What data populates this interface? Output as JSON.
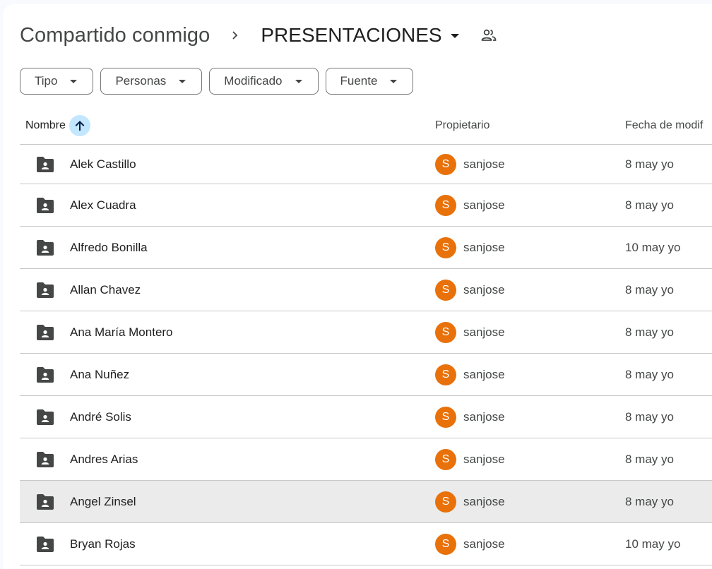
{
  "breadcrumb": {
    "root": "Compartido conmigo",
    "current": "PRESENTACIONES"
  },
  "filters": [
    {
      "label": "Tipo"
    },
    {
      "label": "Personas"
    },
    {
      "label": "Modificado"
    },
    {
      "label": "Fuente"
    }
  ],
  "table": {
    "columns": {
      "name": "Nombre",
      "owner": "Propietario",
      "date": "Fecha de modif"
    },
    "sort": "ascending",
    "rows": [
      {
        "name": "Alek Castillo",
        "owner": "sanjose",
        "owner_initial": "S",
        "date": "8 may yo",
        "selected": false
      },
      {
        "name": "Alex Cuadra",
        "owner": "sanjose",
        "owner_initial": "S",
        "date": "8 may yo",
        "selected": false
      },
      {
        "name": "Alfredo Bonilla",
        "owner": "sanjose",
        "owner_initial": "S",
        "date": "10 may yo",
        "selected": false
      },
      {
        "name": "Allan Chavez",
        "owner": "sanjose",
        "owner_initial": "S",
        "date": "8 may yo",
        "selected": false
      },
      {
        "name": "Ana María Montero",
        "owner": "sanjose",
        "owner_initial": "S",
        "date": "8 may yo",
        "selected": false
      },
      {
        "name": "Ana Nuñez",
        "owner": "sanjose",
        "owner_initial": "S",
        "date": "8 may yo",
        "selected": false
      },
      {
        "name": "André Solis",
        "owner": "sanjose",
        "owner_initial": "S",
        "date": "8 may yo",
        "selected": false
      },
      {
        "name": "Andres Arias",
        "owner": "sanjose",
        "owner_initial": "S",
        "date": "8 may yo",
        "selected": false
      },
      {
        "name": "Angel Zinsel",
        "owner": "sanjose",
        "owner_initial": "S",
        "date": "8 may yo",
        "selected": true
      },
      {
        "name": "Bryan Rojas",
        "owner": "sanjose",
        "owner_initial": "S",
        "date": "10 may yo",
        "selected": false
      }
    ]
  },
  "colors": {
    "avatar": "#e8710a",
    "sort_button": "#c2e7ff",
    "selected_row": "#ebebeb"
  },
  "icons": {
    "folder": "shared-folder-icon",
    "shared": "people-icon",
    "sort": "arrow-up-icon"
  }
}
